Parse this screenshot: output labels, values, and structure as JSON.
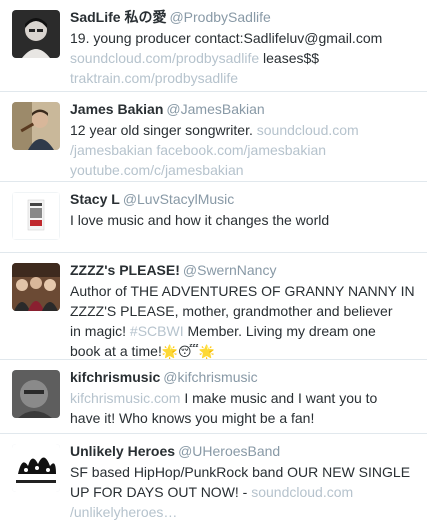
{
  "users": [
    {
      "name": "SadLife 私の愛",
      "handle": "@ProdbySadlife",
      "bio_l1": "19. young producer contact:Sadlifeluv@gmail.com",
      "bio_l2_link": "soundcloud.com/prodbysadlife",
      "bio_l2_text": " leases$$",
      "bio_l3_link": "traktrain.com/prodbysadlife"
    },
    {
      "name": "James Bakian",
      "handle": "@JamesBakian",
      "bio_l1_text": "12 year old singer songwriter. ",
      "bio_l1_link": "soundcloud.com",
      "bio_l2_link": "/jamesbakian facebook.com/jamesbakian",
      "bio_l3_link": "youtube.com/c/jamesbakian"
    },
    {
      "name": "Stacy L",
      "handle": "@LuvStacylMusic",
      "bio_l1": "I love music and how it changes the world"
    },
    {
      "name": "ZZZZ's PLEASE!",
      "handle": "@SwernNancy",
      "bio_l1": "Author of THE ADVENTURES OF GRANNY NANNY IN",
      "bio_l2": "ZZZZ'S PLEASE, mother, grandmother and believer",
      "bio_l3_text": "in magic! ",
      "bio_l3_tag": "#SCBWI",
      "bio_l3_text2": " Member. Living my dream one",
      "bio_l4": "book at a time!",
      "emoji": [
        "🌟",
        "😴",
        "🌟"
      ]
    },
    {
      "name": "kifchrismusic",
      "handle": "@kifchrismusic",
      "bio_l1_link": "kifchrismusic.com",
      "bio_l1_text": " I make music and I want you to",
      "bio_l2": "have it! Who knows you might be a fan!"
    },
    {
      "name": "Unlikely Heroes",
      "handle": "@UHeroesBand",
      "bio_l1": "SF based HipHop/PunkRock band OUR NEW SINGLE",
      "bio_l2_text": "UP FOR DAYS OUT NOW! - ",
      "bio_l2_link": "soundcloud.com",
      "bio_l3_link": "/unlikelyheroes…"
    }
  ],
  "colors": {
    "text": "#292f33",
    "handle": "#8899a6",
    "link": "#b6c3cd",
    "divider": "#e1e8ed"
  }
}
